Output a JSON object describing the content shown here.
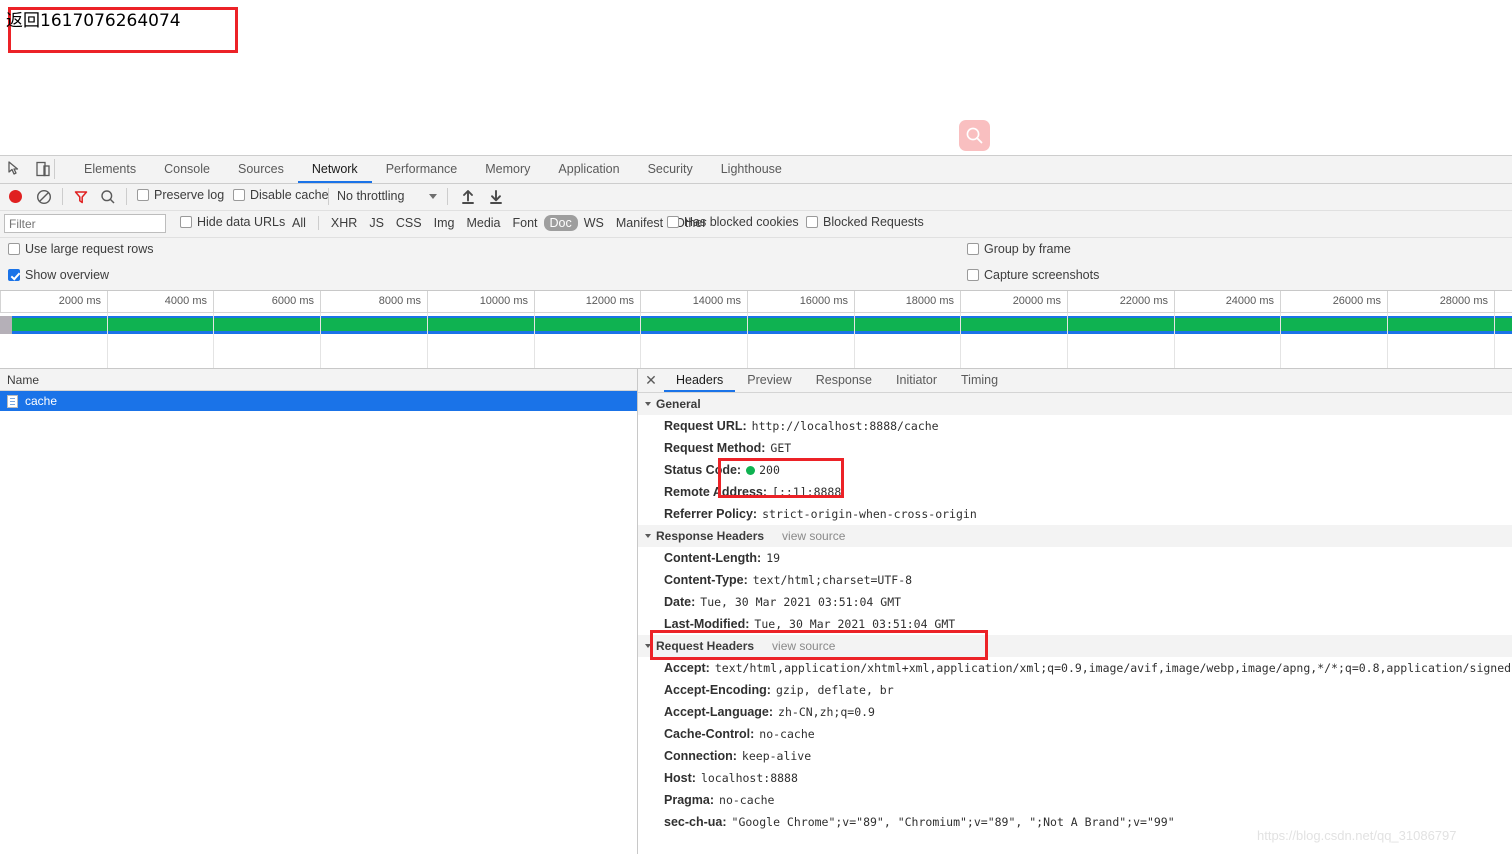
{
  "page": {
    "return_text": "返回1617076264074",
    "search_icon": "search-icon",
    "watermark": "https://blog.csdn.net/qq_31086797"
  },
  "devtools": {
    "tabs": [
      {
        "label": "Elements",
        "active": false
      },
      {
        "label": "Console",
        "active": false
      },
      {
        "label": "Sources",
        "active": false
      },
      {
        "label": "Network",
        "active": true
      },
      {
        "label": "Performance",
        "active": false
      },
      {
        "label": "Memory",
        "active": false
      },
      {
        "label": "Application",
        "active": false
      },
      {
        "label": "Security",
        "active": false
      },
      {
        "label": "Lighthouse",
        "active": false
      }
    ],
    "controls": {
      "record_icon": "record-icon",
      "clear_icon": "clear-icon",
      "filter_icon": "filter-funnel-icon",
      "search_icon": "search-icon",
      "preserve_log": "Preserve log",
      "preserve_log_checked": false,
      "disable_cache": "Disable cache",
      "disable_cache_checked": false,
      "throttling": "No throttling",
      "import_icon": "import-har-icon",
      "export_icon": "export-har-icon"
    },
    "filter": {
      "placeholder": "Filter",
      "value": "",
      "hide_data_urls": "Hide data URLs",
      "hide_data_urls_checked": false,
      "types": [
        "All",
        "XHR",
        "JS",
        "CSS",
        "Img",
        "Media",
        "Font",
        "Doc",
        "WS",
        "Manifest",
        "Other"
      ],
      "selected_type": "Doc",
      "has_blocked_cookies": "Has blocked cookies",
      "has_blocked_cookies_checked": false,
      "blocked_requests": "Blocked Requests",
      "blocked_requests_checked": false
    },
    "options": {
      "use_large_request_rows": "Use large request rows",
      "use_large_request_rows_checked": false,
      "show_overview": "Show overview",
      "show_overview_checked": true,
      "group_by_frame": "Group by frame",
      "group_by_frame_checked": false,
      "capture_screenshots": "Capture screenshots",
      "capture_screenshots_checked": false
    },
    "timeline": {
      "ticks": [
        "2000 ms",
        "4000 ms",
        "6000 ms",
        "8000 ms",
        "10000 ms",
        "12000 ms",
        "14000 ms",
        "16000 ms",
        "18000 ms",
        "20000 ms",
        "22000 ms",
        "24000 ms",
        "26000 ms",
        "28000 ms"
      ],
      "band_blue": "#1a73e8",
      "band_green": "#0fb251"
    },
    "requests": {
      "column_name": "Name",
      "rows": [
        {
          "name": "cache",
          "selected": true,
          "icon": "document-icon"
        }
      ]
    },
    "details": {
      "close_icon": "close-icon",
      "tabs": [
        {
          "label": "Headers",
          "active": true
        },
        {
          "label": "Preview",
          "active": false
        },
        {
          "label": "Response",
          "active": false
        },
        {
          "label": "Initiator",
          "active": false
        },
        {
          "label": "Timing",
          "active": false
        }
      ],
      "general": {
        "title": "General",
        "rows": [
          {
            "name": "Request URL:",
            "value": "http://localhost:8888/cache"
          },
          {
            "name": "Request Method:",
            "value": "GET"
          },
          {
            "name": "Status Code:",
            "value": "200",
            "status_dot": "#0fb251"
          },
          {
            "name": "Remote Address:",
            "value": "[::1]:8888"
          },
          {
            "name": "Referrer Policy:",
            "value": "strict-origin-when-cross-origin"
          }
        ]
      },
      "response_headers": {
        "title": "Response Headers",
        "view_source": "view source",
        "rows": [
          {
            "name": "Content-Length:",
            "value": "19"
          },
          {
            "name": "Content-Type:",
            "value": "text/html;charset=UTF-8"
          },
          {
            "name": "Date:",
            "value": "Tue, 30 Mar 2021 03:51:04 GMT"
          },
          {
            "name": "Last-Modified:",
            "value": "Tue, 30 Mar 2021 03:51:04 GMT"
          }
        ]
      },
      "request_headers": {
        "title": "Request Headers",
        "view_source": "view source",
        "rows": [
          {
            "name": "Accept:",
            "value": "text/html,application/xhtml+xml,application/xml;q=0.9,image/avif,image/webp,image/apng,*/*;q=0.8,application/signed-excha"
          },
          {
            "name": "Accept-Encoding:",
            "value": "gzip, deflate, br"
          },
          {
            "name": "Accept-Language:",
            "value": "zh-CN,zh;q=0.9"
          },
          {
            "name": "Cache-Control:",
            "value": "no-cache"
          },
          {
            "name": "Connection:",
            "value": "keep-alive"
          },
          {
            "name": "Host:",
            "value": "localhost:8888"
          },
          {
            "name": "Pragma:",
            "value": "no-cache"
          },
          {
            "name": "sec-ch-ua:",
            "value": "\"Google Chrome\";v=\"89\", \"Chromium\";v=\"89\", \";Not A Brand\";v=\"99\""
          }
        ]
      }
    }
  }
}
